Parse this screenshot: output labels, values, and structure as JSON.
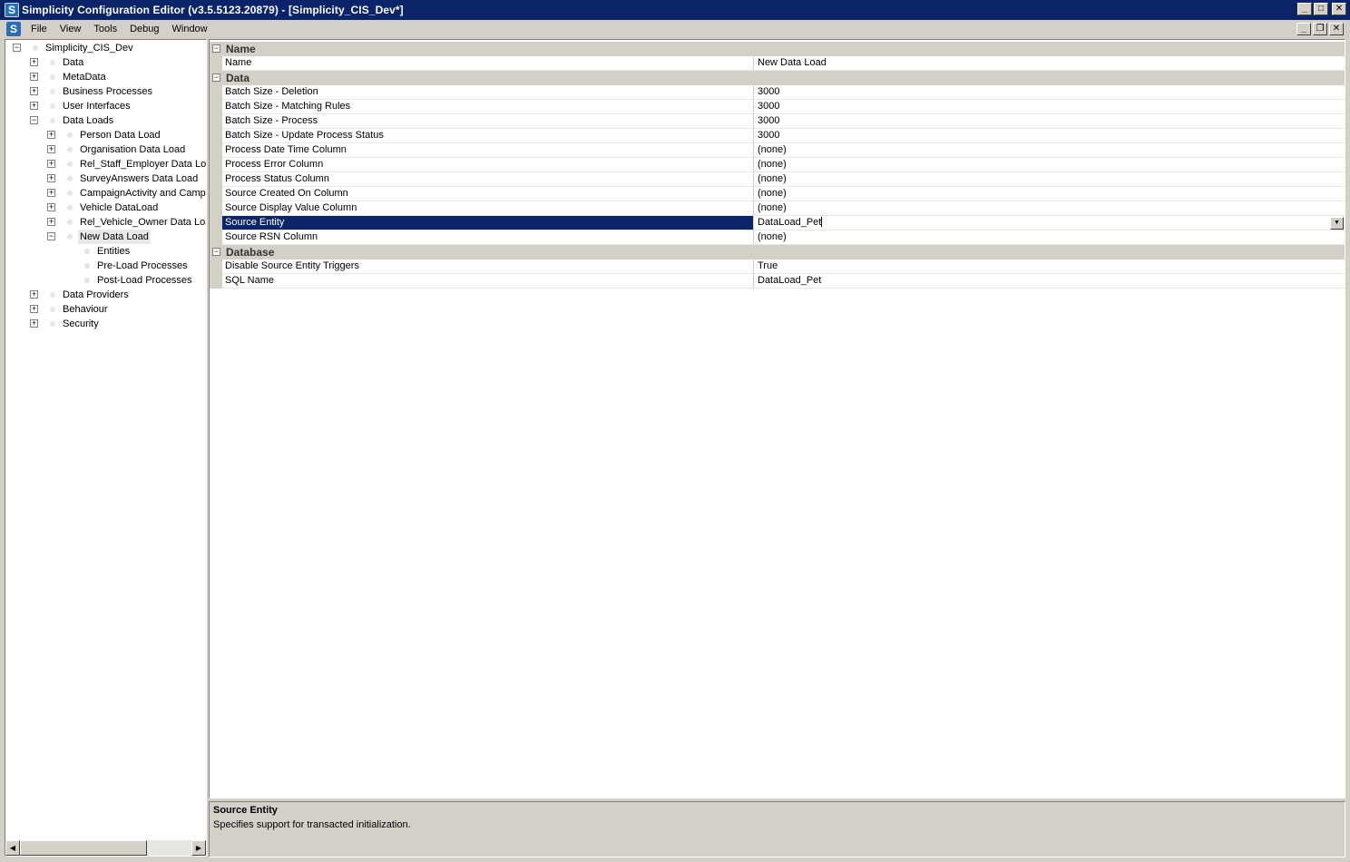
{
  "window": {
    "title": "Simplicity Configuration Editor (v3.5.5123.20879) - [Simplicity_CIS_Dev*]",
    "app_icon": "S",
    "minimize": "_",
    "maximize": "□",
    "close": "✕"
  },
  "menu": {
    "doc_icon": "S",
    "items": [
      "File",
      "View",
      "Tools",
      "Debug",
      "Window"
    ],
    "mdi_minimize": "_",
    "mdi_restore": "❐",
    "mdi_close": "✕"
  },
  "tree": {
    "nodes": [
      {
        "label": "Simplicity_CIS_Dev",
        "expander": "−"
      },
      {
        "label": "Data",
        "expander": "+"
      },
      {
        "label": "MetaData",
        "expander": "+"
      },
      {
        "label": "Business Processes",
        "expander": "+"
      },
      {
        "label": "User Interfaces",
        "expander": "+"
      },
      {
        "label": "Data Loads",
        "expander": "−"
      },
      {
        "label": "Person Data Load",
        "expander": "+"
      },
      {
        "label": "Organisation Data Load",
        "expander": "+"
      },
      {
        "label": "Rel_Staff_Employer Data Load",
        "expander": "+"
      },
      {
        "label": "SurveyAnswers Data Load",
        "expander": "+"
      },
      {
        "label": "CampaignActivity and Campaign",
        "expander": "+"
      },
      {
        "label": "Vehicle DataLoad",
        "expander": "+"
      },
      {
        "label": "Rel_Vehicle_Owner Data Load",
        "expander": "+"
      },
      {
        "label": "New Data Load",
        "expander": "−"
      },
      {
        "label": "Entities",
        "expander": ""
      },
      {
        "label": "Pre-Load Processes",
        "expander": ""
      },
      {
        "label": "Post-Load Processes",
        "expander": ""
      },
      {
        "label": "Data Providers",
        "expander": "+"
      },
      {
        "label": "Behaviour",
        "expander": "+"
      },
      {
        "label": "Security",
        "expander": "+"
      }
    ],
    "scroll_left": "◀",
    "scroll_right": "▶"
  },
  "grid": {
    "categories": [
      {
        "label": "Name",
        "expander": "−"
      },
      {
        "label": "Data",
        "expander": "−"
      },
      {
        "label": "Database",
        "expander": "−"
      }
    ],
    "properties": [
      {
        "name": "Name",
        "value": "New Data Load"
      },
      {
        "name": "Batch Size - Deletion",
        "value": "3000"
      },
      {
        "name": "Batch Size - Matching Rules",
        "value": "3000"
      },
      {
        "name": "Batch Size - Process",
        "value": "3000"
      },
      {
        "name": "Batch Size - Update Process Status",
        "value": "3000"
      },
      {
        "name": "Process Date Time Column",
        "value": "(none)"
      },
      {
        "name": "Process Error Column",
        "value": "(none)"
      },
      {
        "name": "Process Status Column",
        "value": "(none)"
      },
      {
        "name": "Source Created On Column",
        "value": "(none)"
      },
      {
        "name": "Source Display Value Column",
        "value": "(none)"
      },
      {
        "name": "Source Entity",
        "value": "DataLoad_Pet"
      },
      {
        "name": "Source RSN Column",
        "value": "(none)"
      },
      {
        "name": "Disable Source Entity Triggers",
        "value": "True"
      },
      {
        "name": "SQL Name",
        "value": "DataLoad_Pet"
      }
    ],
    "dropdown_arrow": "▼"
  },
  "description": {
    "title": "Source Entity",
    "text": "Specifies support for transacted initialization."
  }
}
